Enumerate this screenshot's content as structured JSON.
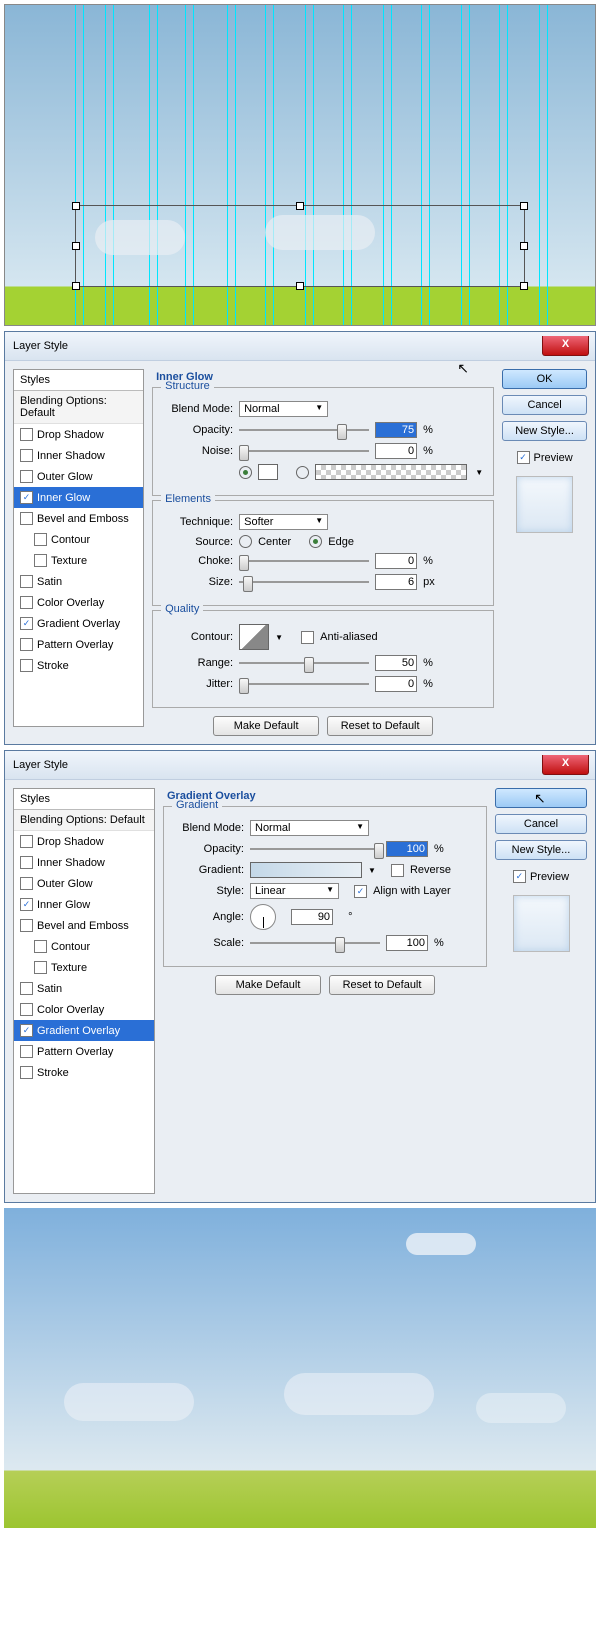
{
  "dialog_title": "Layer Style",
  "close_x": "X",
  "styles_header": "Styles",
  "blending_options": "Blending Options: Default",
  "style_items": {
    "drop_shadow": "Drop Shadow",
    "inner_shadow": "Inner Shadow",
    "outer_glow": "Outer Glow",
    "inner_glow": "Inner Glow",
    "bevel_emboss": "Bevel and Emboss",
    "contour": "Contour",
    "texture": "Texture",
    "satin": "Satin",
    "color_overlay": "Color Overlay",
    "gradient_overlay": "Gradient Overlay",
    "pattern_overlay": "Pattern Overlay",
    "stroke": "Stroke"
  },
  "buttons": {
    "ok": "OK",
    "cancel": "Cancel",
    "new_style": "New Style...",
    "preview": "Preview",
    "make_default": "Make Default",
    "reset_default": "Reset to Default"
  },
  "dlg1": {
    "title": "Inner Glow",
    "groups": {
      "structure": "Structure",
      "elements": "Elements",
      "quality": "Quality"
    },
    "labels": {
      "blend_mode": "Blend Mode:",
      "opacity": "Opacity:",
      "noise": "Noise:",
      "technique": "Technique:",
      "source": "Source:",
      "center": "Center",
      "edge": "Edge",
      "choke": "Choke:",
      "size": "Size:",
      "contour": "Contour:",
      "anti": "Anti-aliased",
      "range": "Range:",
      "jitter": "Jitter:"
    },
    "values": {
      "blend_mode": "Normal",
      "opacity": "75",
      "noise": "0",
      "technique": "Softer",
      "choke": "0",
      "size": "6",
      "range": "50",
      "jitter": "0"
    },
    "units": {
      "pct": "%",
      "px": "px"
    }
  },
  "dlg2": {
    "title": "Gradient Overlay",
    "groups": {
      "gradient": "Gradient"
    },
    "labels": {
      "blend_mode": "Blend Mode:",
      "opacity": "Opacity:",
      "gradient": "Gradient:",
      "reverse": "Reverse",
      "style": "Style:",
      "align": "Align with Layer",
      "angle": "Angle:",
      "scale": "Scale:",
      "deg": "°"
    },
    "values": {
      "blend_mode": "Normal",
      "opacity": "100",
      "style": "Linear",
      "angle": "90",
      "scale": "100"
    },
    "units": {
      "pct": "%"
    }
  }
}
